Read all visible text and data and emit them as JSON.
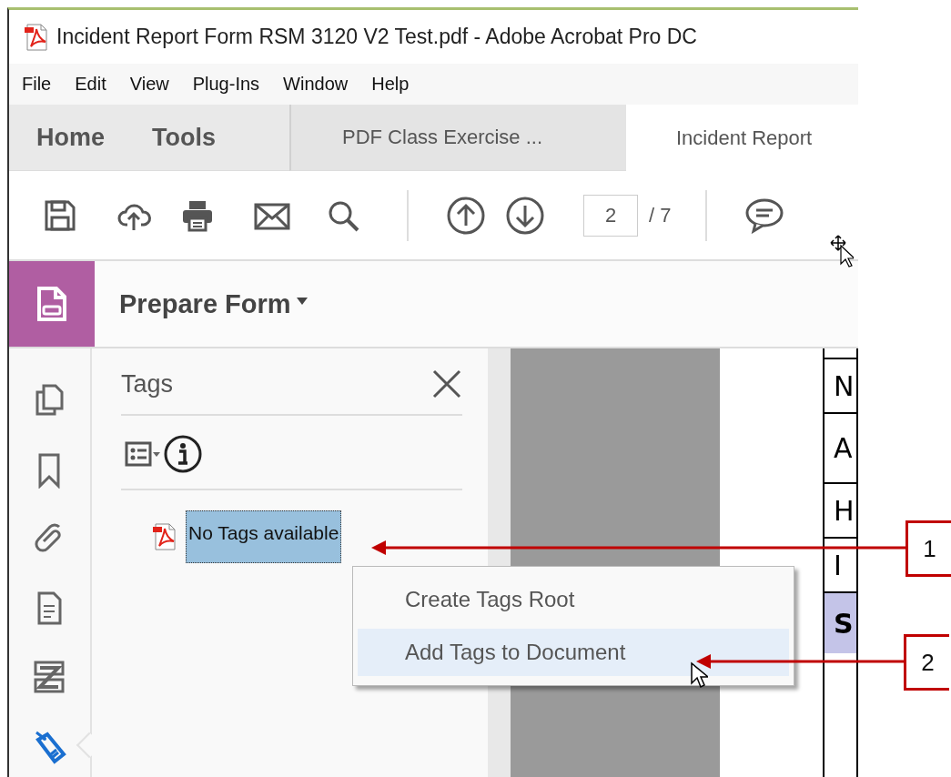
{
  "window": {
    "title": "Incident Report Form RSM 3120 V2 Test.pdf - Adobe Acrobat Pro DC"
  },
  "menu_bar": [
    "File",
    "Edit",
    "View",
    "Plug-Ins",
    "Window",
    "Help"
  ],
  "nav": [
    "Home",
    "Tools"
  ],
  "tabs": [
    {
      "label": "PDF Class Exercise ...",
      "selected": false
    },
    {
      "label": "Incident Report",
      "selected": true
    }
  ],
  "toolbar": {
    "page": "2",
    "page_total": "/ 7"
  },
  "tool_panel": {
    "title": "Prepare Form"
  },
  "side_rail": [
    {
      "kind": "pages",
      "selected": false
    },
    {
      "kind": "bookmark",
      "selected": false
    },
    {
      "kind": "attachment",
      "selected": false
    },
    {
      "kind": "page",
      "selected": false
    },
    {
      "kind": "compare",
      "selected": false
    },
    {
      "kind": "tag",
      "selected": true
    }
  ],
  "tags_panel": {
    "title": "Tags",
    "items": [
      {
        "label": "No Tags available",
        "selected": true
      }
    ]
  },
  "document": {
    "cells": [
      {
        "text": "N",
        "highlighted": false
      },
      {
        "text": "A",
        "highlighted": false
      },
      {
        "text": "H",
        "highlighted": false
      },
      {
        "text": "I",
        "highlighted": false
      },
      {
        "text": "S",
        "highlighted": true
      }
    ]
  },
  "context_menu": [
    {
      "label": "Create Tags Root",
      "selected": false
    },
    {
      "label": "Add Tags to Document",
      "selected": true
    }
  ],
  "callouts": [
    {
      "label": "1"
    },
    {
      "label": "2"
    }
  ]
}
